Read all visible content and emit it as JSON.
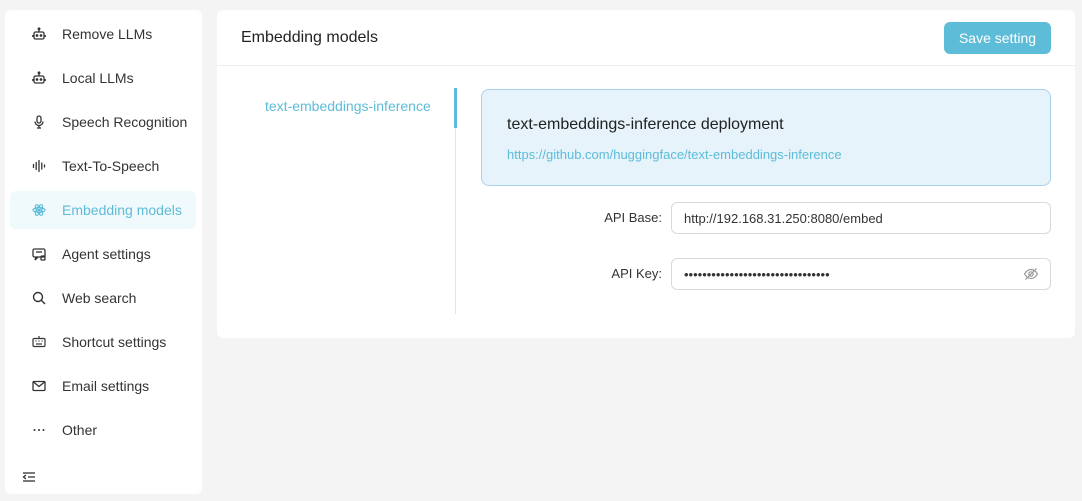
{
  "sidebar": {
    "items": [
      {
        "label": "Remove LLMs",
        "icon": "robot-icon",
        "active": false
      },
      {
        "label": "Local LLMs",
        "icon": "robot-icon",
        "active": false
      },
      {
        "label": "Speech Recognition",
        "icon": "microphone-icon",
        "active": false
      },
      {
        "label": "Text-To-Speech",
        "icon": "soundwave-icon",
        "active": false
      },
      {
        "label": "Embedding models",
        "icon": "atom-icon",
        "active": true
      },
      {
        "label": "Agent settings",
        "icon": "agent-icon",
        "active": false
      },
      {
        "label": "Web search",
        "icon": "search-icon",
        "active": false
      },
      {
        "label": "Shortcut settings",
        "icon": "keyboard-icon",
        "active": false
      },
      {
        "label": "Email settings",
        "icon": "mail-icon",
        "active": false
      },
      {
        "label": "Other",
        "icon": "ellipsis-icon",
        "active": false
      }
    ],
    "collapse_icon": "menu-fold-icon"
  },
  "main": {
    "title": "Embedding models",
    "save_label": "Save setting",
    "tabs": [
      {
        "label": "text-embeddings-inference",
        "active": true
      }
    ],
    "card": {
      "title": "text-embeddings-inference deployment",
      "link": "https://github.com/huggingface/text-embeddings-inference"
    },
    "form": {
      "api_base_label": "API Base:",
      "api_base_value": "http://192.168.31.250:8080/embed",
      "api_key_label": "API Key:",
      "api_key_value": "••••••••••••••••••••••••••••••••"
    }
  },
  "colors": {
    "accent": "#5dbcd8",
    "active_bg": "#f0f9fc",
    "card_bg": "#e6f3fb",
    "card_border": "#a9d3ea",
    "page_bg": "#f4f4f4"
  }
}
